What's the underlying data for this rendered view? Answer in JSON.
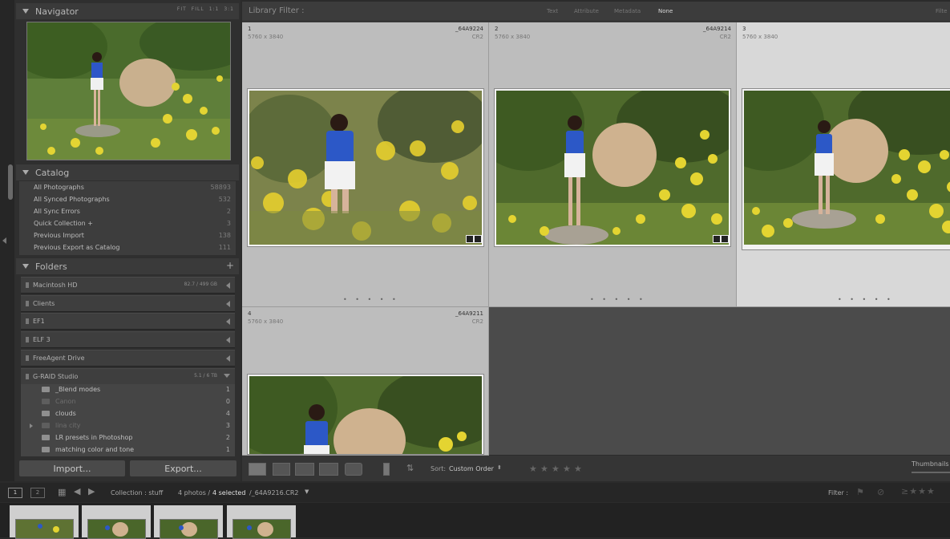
{
  "navigator": {
    "title": "Navigator",
    "zoom_options": [
      "FIT",
      "FILL",
      "1:1",
      "3:1"
    ]
  },
  "catalog": {
    "title": "Catalog",
    "items": [
      {
        "label": "All Photographs",
        "count": "58893"
      },
      {
        "label": "All Synced Photographs",
        "count": "532"
      },
      {
        "label": "All Sync Errors",
        "count": "2"
      },
      {
        "label": "Quick Collection +",
        "count": "3"
      },
      {
        "label": "Previous Import",
        "count": "138"
      },
      {
        "label": "Previous Export as Catalog",
        "count": "111"
      }
    ]
  },
  "folders": {
    "title": "Folders",
    "volumes": [
      {
        "label": "Macintosh HD",
        "capacity": "82.7 / 499 GB"
      },
      {
        "label": "Clients",
        "capacity": ""
      },
      {
        "label": "EF1",
        "capacity": ""
      },
      {
        "label": "ELF 3",
        "capacity": ""
      },
      {
        "label": "FreeAgent Drive",
        "capacity": ""
      },
      {
        "label": "G-RAID Studio",
        "capacity": "5.1 / 6 TB"
      }
    ],
    "subfolders": [
      {
        "label": "_Blend modes",
        "count": "1"
      },
      {
        "label": "Canon",
        "count": "0"
      },
      {
        "label": "clouds",
        "count": "4"
      },
      {
        "label": "lina city",
        "count": "3"
      },
      {
        "label": "LR presets in Photoshop",
        "count": "2"
      },
      {
        "label": "matching color and tone",
        "count": "1"
      }
    ]
  },
  "buttons": {
    "import": "Import...",
    "export": "Export..."
  },
  "filter_bar": {
    "title": "Library Filter :",
    "options": [
      "Text",
      "Attribute",
      "Metadata",
      "None"
    ],
    "active": "None",
    "right_label": "Filte"
  },
  "grid": {
    "cells": [
      {
        "index": "1",
        "filename": "_64A9224",
        "dims": "5760 x 3840",
        "ext": "CR2"
      },
      {
        "index": "2",
        "filename": "_64A9214",
        "dims": "5760 x 3840",
        "ext": "CR2"
      },
      {
        "index": "3",
        "filename": "",
        "dims": "5760 x 3840",
        "ext": ""
      },
      {
        "index": "4",
        "filename": "_64A9211",
        "dims": "5760 x 3840",
        "ext": "CR2"
      }
    ],
    "dots": "• • • • •"
  },
  "toolbar": {
    "sort_label": "Sort:",
    "sort_value": "Custom Order",
    "thumbnails_label": "Thumbnails"
  },
  "filmstrip_header": {
    "page_1": "1",
    "page_2": "2",
    "collection": "Collection : stuff",
    "photos_info_prefix": "4 photos /",
    "selected": "4 selected",
    "photos_info_suffix": "/_64A9216.CR2",
    "filter_label": "Filter :"
  },
  "colors": {
    "panel_bg": "#2f2f2f",
    "grid_cell": "#bdbdbd",
    "selected_cell": "#d8d8d8",
    "empty_grid": "#4b4b4b"
  }
}
